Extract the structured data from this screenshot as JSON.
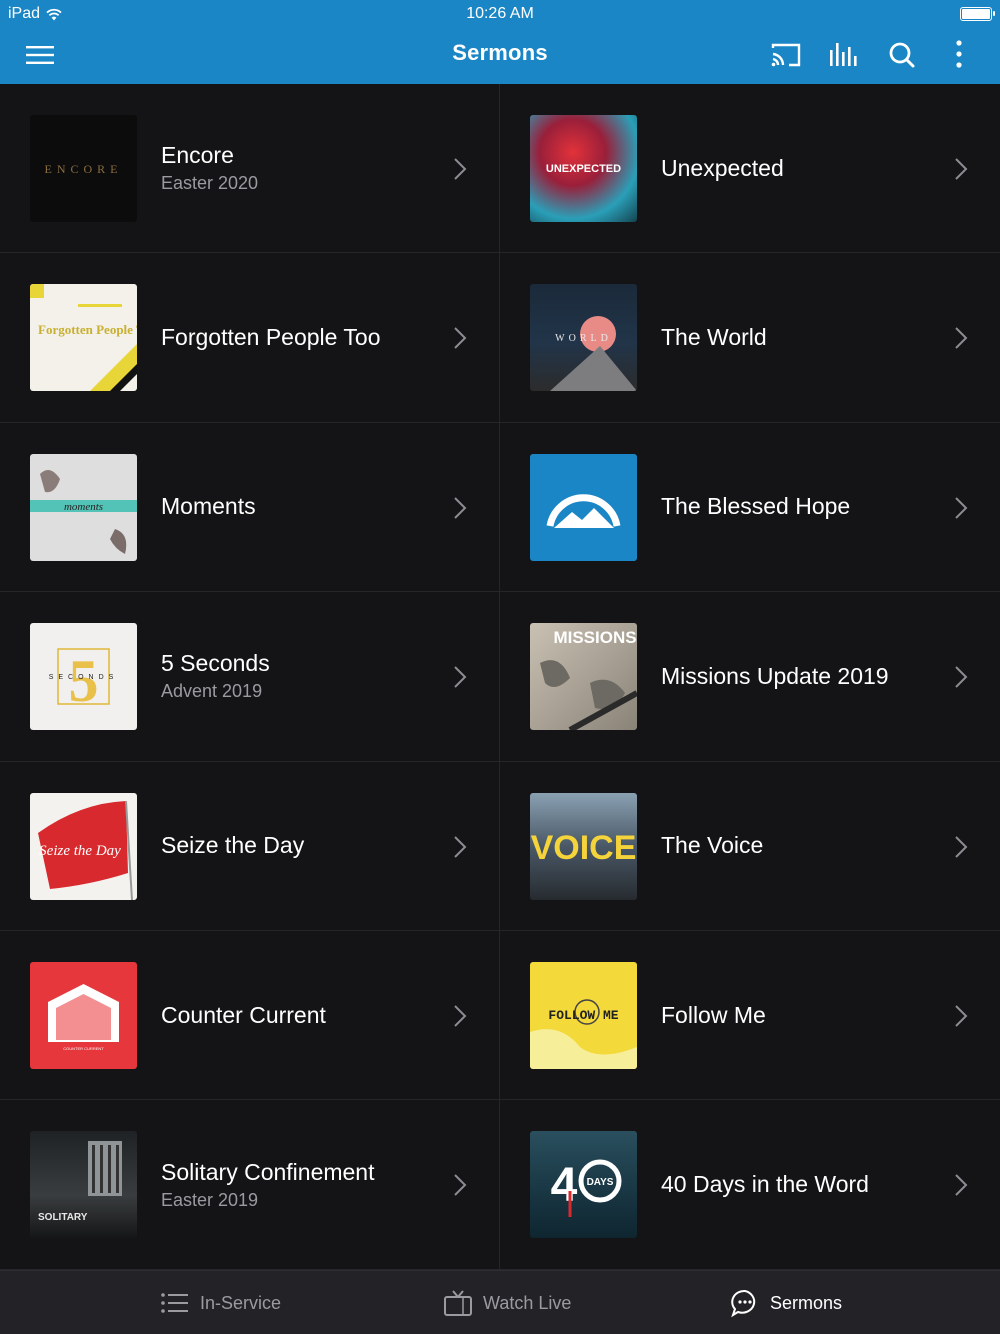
{
  "status_bar": {
    "carrier": "iPad",
    "time": "10:26 AM"
  },
  "header": {
    "title": "Sermons",
    "icons": [
      "menu-icon",
      "cast-icon",
      "audio-bars-icon",
      "search-icon",
      "more-vertical-icon"
    ],
    "accent_color": "#1a86c5"
  },
  "series": [
    {
      "title": "Encore",
      "subtitle": "Easter 2020",
      "art_text": "ENCORE"
    },
    {
      "title": "Unexpected",
      "subtitle": "",
      "art_text": "UNEXPECTED"
    },
    {
      "title": "Forgotten People Too",
      "subtitle": "",
      "art_text": "Forgotten People Too"
    },
    {
      "title": "The World",
      "subtitle": "",
      "art_text": "WORLD"
    },
    {
      "title": "Moments",
      "subtitle": "",
      "art_text": "moments"
    },
    {
      "title": "The Blessed Hope",
      "subtitle": "",
      "art_text": ""
    },
    {
      "title": "5 Seconds",
      "subtitle": "Advent 2019",
      "art_text": "SECONDS"
    },
    {
      "title": "Missions Update 2019",
      "subtitle": "",
      "art_text": "MISSIONS"
    },
    {
      "title": "Seize the Day",
      "subtitle": "",
      "art_text": "Seize the Day"
    },
    {
      "title": "The Voice",
      "subtitle": "",
      "art_text": "VOICE"
    },
    {
      "title": "Counter Current",
      "subtitle": "",
      "art_text": "COUNTER CURRENT"
    },
    {
      "title": "Follow Me",
      "subtitle": "",
      "art_text": "FOLLOW ME"
    },
    {
      "title": "Solitary Confinement",
      "subtitle": "Easter 2019",
      "art_text": "SOLITARY"
    },
    {
      "title": "40 Days in the Word",
      "subtitle": "",
      "art_text": "DAYS"
    }
  ],
  "tabbar": {
    "tabs": [
      {
        "label": "In-Service",
        "icon": "list-icon",
        "active": false
      },
      {
        "label": "Watch Live",
        "icon": "tv-icon",
        "active": false
      },
      {
        "label": "Sermons",
        "icon": "chat-bubble-icon",
        "active": true
      }
    ]
  }
}
